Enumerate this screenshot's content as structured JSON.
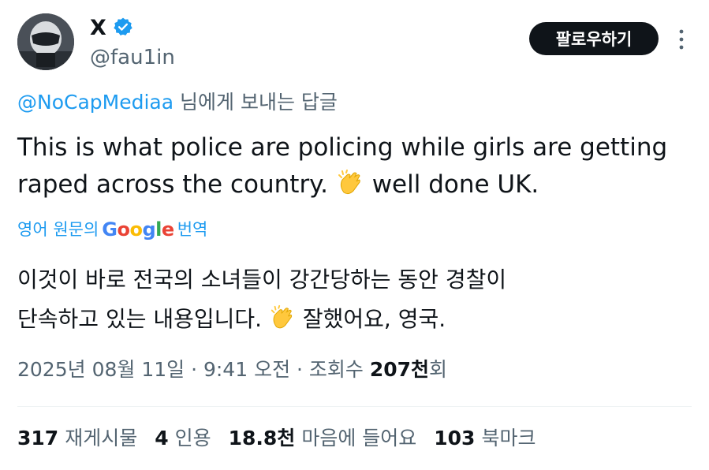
{
  "author": {
    "name": "X",
    "handle": "@fau1in",
    "verified_icon": "verified-badge-icon",
    "verified_color": "#1d9bf0"
  },
  "actions": {
    "follow_label": "팔로우하기",
    "more_icon": "more-vertical-icon"
  },
  "reply": {
    "mention": "@NoCapMediaa",
    "suffix": " 님에게 보내는 답글"
  },
  "tweet": {
    "line1": "This is what police are policing while girls are getting",
    "line2_a": "raped across the country. ",
    "line2_emoji": "clapping-hands-emoji",
    "line2_b": " well done UK."
  },
  "translation": {
    "prefix": "영어 원문의",
    "brand": "Google",
    "suffix": "번역",
    "line1": "이것이 바로 전국의 소녀들이 강간당하는 동안 경찰이",
    "line2_a": "단속하고 있는 내용입니다. ",
    "line2_emoji": "clapping-hands-emoji",
    "line2_b": " 잘했어요, 영국."
  },
  "meta": {
    "datetime": "2025년 08월 11일 · 9:41 오전 · 조회수 ",
    "views": "207천",
    "views_suffix": "회"
  },
  "stats": [
    {
      "count": "317",
      "label": "재게시물"
    },
    {
      "count": "4",
      "label": "인용"
    },
    {
      "count": "18.8천",
      "label": "마음에 들어요"
    },
    {
      "count": "103",
      "label": "북마크"
    }
  ],
  "colors": {
    "accent": "#1d9bf0",
    "text": "#0f1419",
    "muted": "#536471",
    "button_bg": "#0f1419"
  }
}
